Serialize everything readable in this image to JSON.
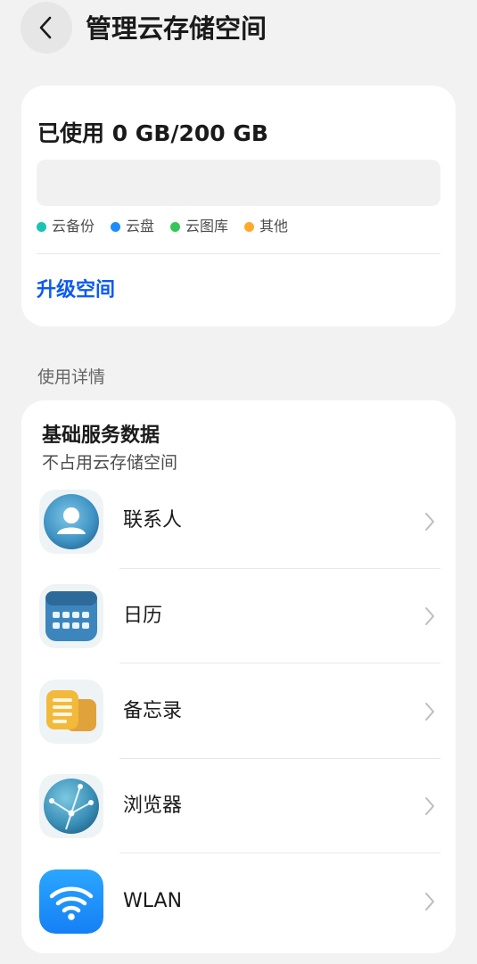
{
  "header": {
    "title": "管理云存储空间",
    "back_icon": "chevron-left-icon"
  },
  "storage": {
    "used_text": "已使用 0 GB/200 GB",
    "used_fraction": 0,
    "legend": [
      {
        "label": "云备份",
        "color": "#1cc3b2"
      },
      {
        "label": "云盘",
        "color": "#1a8cff"
      },
      {
        "label": "云图库",
        "color": "#36c55a"
      },
      {
        "label": "其他",
        "color": "#ffaa2a"
      }
    ],
    "upgrade_label": "升级空间"
  },
  "details": {
    "section_label": "使用详情",
    "group_title": "基础服务数据",
    "group_subtitle": "不占用云存储空间",
    "items": [
      {
        "label": "联系人",
        "icon": "contacts-icon"
      },
      {
        "label": "日历",
        "icon": "calendar-icon"
      },
      {
        "label": "备忘录",
        "icon": "notes-icon"
      },
      {
        "label": "浏览器",
        "icon": "browser-icon"
      },
      {
        "label": "WLAN",
        "icon": "wifi-icon"
      }
    ]
  },
  "colors": {
    "accent": "#0a59f7",
    "background": "#f2f2f2",
    "card": "#ffffff"
  }
}
